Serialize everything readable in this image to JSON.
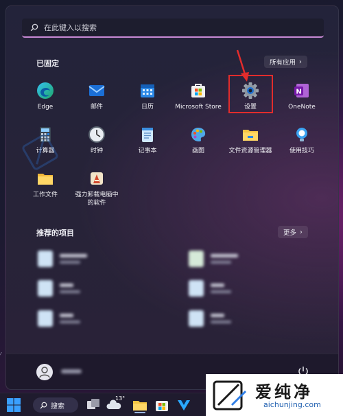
{
  "search": {
    "placeholder": "在此键入以搜索"
  },
  "pinned": {
    "title": "已固定",
    "all_apps_label": "所有应用",
    "apps": [
      {
        "label": "Edge",
        "icon": "edge-icon"
      },
      {
        "label": "邮件",
        "icon": "mail-icon"
      },
      {
        "label": "日历",
        "icon": "calendar-icon"
      },
      {
        "label": "Microsoft Store",
        "icon": "store-icon"
      },
      {
        "label": "设置",
        "icon": "settings-gear-icon"
      },
      {
        "label": "OneNote",
        "icon": "onenote-icon"
      },
      {
        "label": "计算器",
        "icon": "calculator-icon"
      },
      {
        "label": "时钟",
        "icon": "clock-icon"
      },
      {
        "label": "记事本",
        "icon": "notepad-icon"
      },
      {
        "label": "画图",
        "icon": "paint-icon"
      },
      {
        "label": "文件资源管理器",
        "icon": "folder-icon"
      },
      {
        "label": "使用技巧",
        "icon": "tips-bulb-icon"
      },
      {
        "label": "工作文件",
        "icon": "folder-icon"
      },
      {
        "label": "强力卸载电脑中的软件",
        "label_line1": "强力卸载电脑中",
        "label_line2": "的软件",
        "icon": "uninstaller-icon"
      }
    ]
  },
  "recommended": {
    "title": "推荐的项目",
    "more_label": "更多"
  },
  "taskbar": {
    "search_label": "搜索",
    "weather_temp": "13°"
  },
  "watermark": {
    "brand": "爱纯净",
    "url": "aichunjing.com"
  },
  "colors": {
    "accent_underline": "#c98ad6",
    "highlight_red": "#e22c2c"
  }
}
